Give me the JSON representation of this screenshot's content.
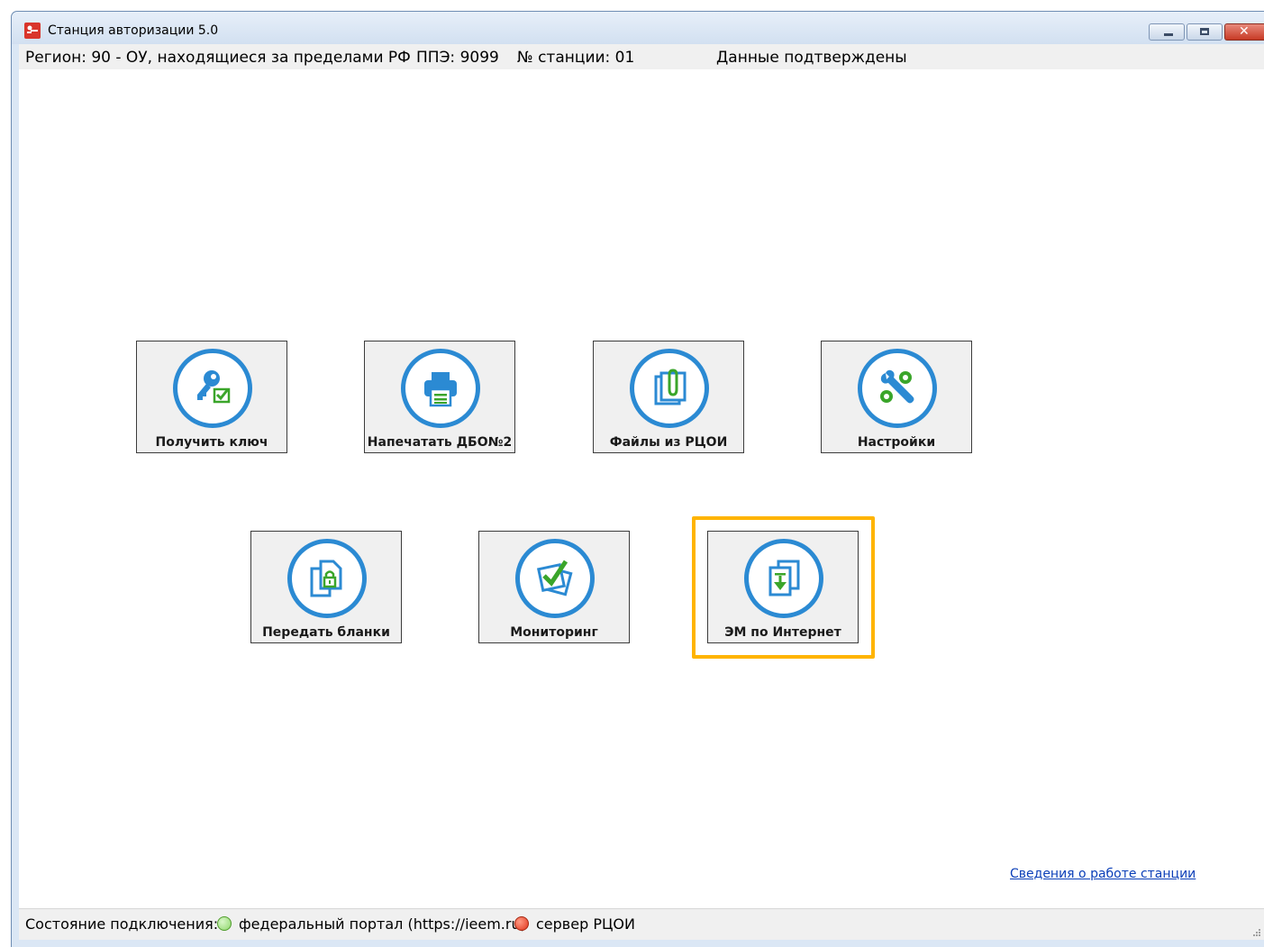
{
  "window": {
    "title": "Станция авторизации 5.0"
  },
  "info_bar": {
    "region": "Регион: 90 - ОУ, находящиеся за пределами РФ",
    "ppe": "ППЭ: 9099",
    "station": "№ станции: 01",
    "status": "Данные подтверждены"
  },
  "tiles": [
    {
      "label": "Получить ключ",
      "icon": "key-check-icon"
    },
    {
      "label": "Напечатать ДБО№2",
      "icon": "printer-icon"
    },
    {
      "label": "Файлы из РЦОИ",
      "icon": "paperclip-files-icon"
    },
    {
      "label": "Настройки",
      "icon": "wrench-gears-icon"
    },
    {
      "label": "Передать бланки",
      "icon": "lock-documents-icon"
    },
    {
      "label": "Мониторинг",
      "icon": "checklist-icon"
    },
    {
      "label": "ЭМ по Интернет",
      "icon": "download-documents-icon"
    }
  ],
  "selected_tile": "ЭМ по Интернет",
  "colors": {
    "icon_ring": "#2b8ad3",
    "icon_accent": "#3aa52a",
    "highlight": "#ffb400",
    "link": "#0b3fb8"
  },
  "link": {
    "label": "Сведения о работе станции"
  },
  "status_bar": {
    "label": "Состояние подключения:",
    "federal_portal": "федеральный портал (https://ieem.ru)",
    "federal_portal_state": "green",
    "rcoi_server": "сервер РЦОИ",
    "rcoi_server_state": "red"
  }
}
